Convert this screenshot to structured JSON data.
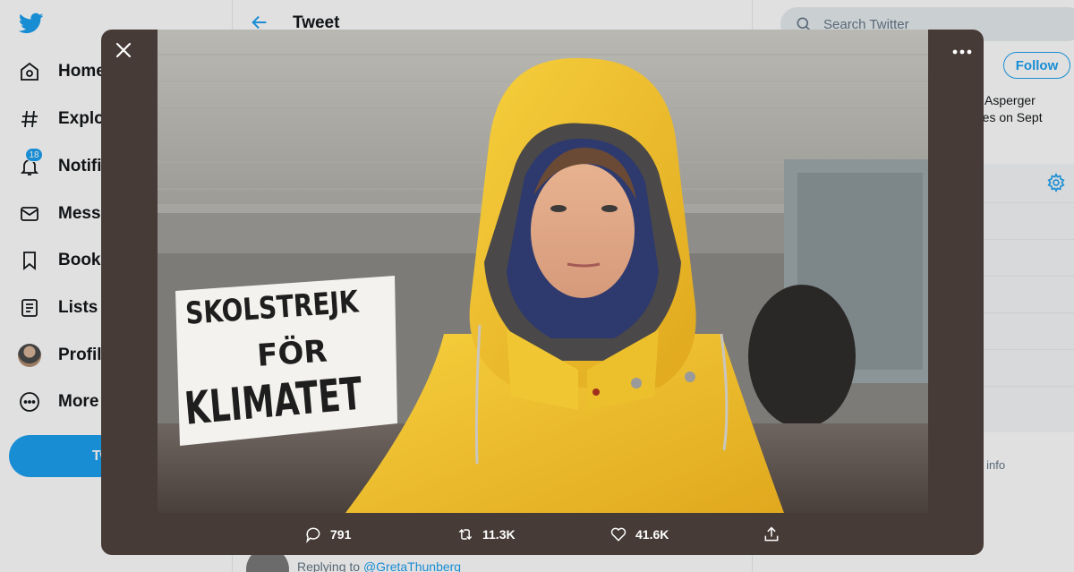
{
  "nav": {
    "items": [
      {
        "label": "Home",
        "icon": "home-icon"
      },
      {
        "label": "Explore",
        "icon": "hashtag-icon"
      },
      {
        "label": "Notifications",
        "icon": "bell-icon",
        "badge": "18"
      },
      {
        "label": "Messages",
        "icon": "envelope-icon"
      },
      {
        "label": "Bookmarks",
        "icon": "bookmark-icon"
      },
      {
        "label": "Lists",
        "icon": "list-icon"
      },
      {
        "label": "Profile",
        "icon": "avatar"
      },
      {
        "label": "More",
        "icon": "more-circle-icon"
      }
    ],
    "tweet_button": "Tweet"
  },
  "center": {
    "title": "Tweet",
    "replying_prefix": "Replying to",
    "replying_mention": "@GretaThunberg"
  },
  "right": {
    "search_placeholder": "Search Twitter",
    "follow_label": "Follow",
    "bio_line1": "with Asperger",
    "bio_line2": "strikes on Sept",
    "bio_more": "e",
    "footer_info": "s info"
  },
  "photo": {
    "sign_line1": "SKOLSTREJK",
    "sign_line2": "FÖR",
    "sign_line3": "KLIMATET"
  },
  "actions": {
    "replies": "791",
    "retweets": "11.3K",
    "likes": "41.6K"
  },
  "colors": {
    "accent": "#1da1f2",
    "modal_bg": "#463b36",
    "raincoat": "#f2c12e"
  }
}
